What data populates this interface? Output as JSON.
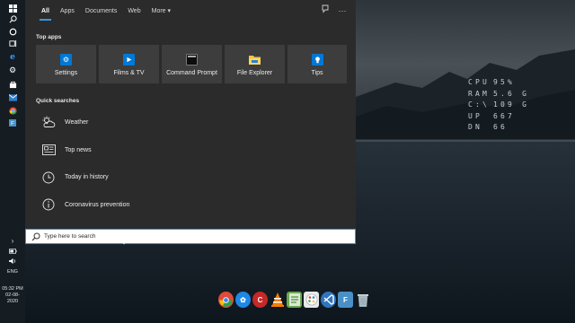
{
  "search_panel": {
    "tabs": [
      {
        "label": "All",
        "active": true
      },
      {
        "label": "Apps",
        "active": false
      },
      {
        "label": "Documents",
        "active": false
      },
      {
        "label": "Web",
        "active": false
      },
      {
        "label": "More",
        "active": false
      }
    ],
    "more_chevron": "▾",
    "header_icons": [
      "feedback-icon",
      "ellipsis-icon"
    ],
    "top_apps_title": "Top apps",
    "top_apps": [
      {
        "label": "Settings",
        "icon": "gear-icon",
        "color": "#0078d7"
      },
      {
        "label": "Films & TV",
        "icon": "play-icon",
        "color": "#0078d7"
      },
      {
        "label": "Command Prompt",
        "icon": "terminal-icon",
        "color": "#0c0c0c"
      },
      {
        "label": "File Explorer",
        "icon": "folder-icon",
        "color": "#f5c342"
      },
      {
        "label": "Tips",
        "icon": "lightbulb-icon",
        "color": "#0078d7"
      }
    ],
    "quick_searches_title": "Quick searches",
    "quick_searches": [
      {
        "label": "Weather",
        "icon": "weather-icon"
      },
      {
        "label": "Top news",
        "icon": "news-icon"
      },
      {
        "label": "Today in history",
        "icon": "clock-icon"
      },
      {
        "label": "Coronavirus prevention",
        "icon": "info-icon"
      }
    ]
  },
  "search": {
    "placeholder": "Type here to search",
    "value": ""
  },
  "sysmon": [
    {
      "label": "CPU",
      "value": "95%"
    },
    {
      "label": "RAM",
      "value": "5.6 G"
    },
    {
      "label": "C:\\",
      "value": "109 G"
    },
    {
      "label": "UP",
      "value": "667"
    },
    {
      "label": "DN",
      "value": "66"
    }
  ],
  "taskbar": {
    "language": "ENG",
    "time": "05:32 PM",
    "date": "02-08-2020",
    "chevron": "›"
  },
  "dock_items": [
    {
      "name": "chrome-icon",
      "color": "#e04b3a"
    },
    {
      "name": "browser-icon",
      "color": "#1e88e5"
    },
    {
      "name": "ccleaner-icon",
      "color": "#c62828"
    },
    {
      "name": "vlc-icon",
      "color": "#f57c00"
    },
    {
      "name": "notepad-icon",
      "color": "#6aa84f"
    },
    {
      "name": "paint-icon",
      "color": "#e53935"
    },
    {
      "name": "vscode-icon",
      "color": "#2f74c0"
    },
    {
      "name": "file-icon",
      "color": "#4a90c8"
    },
    {
      "name": "recycle-bin-icon",
      "color": "#9aaab8"
    }
  ],
  "colors": {
    "accent": "#3a96dd",
    "panel_bg": "#2b2b2b",
    "tile_bg": "#3d3d3d"
  }
}
